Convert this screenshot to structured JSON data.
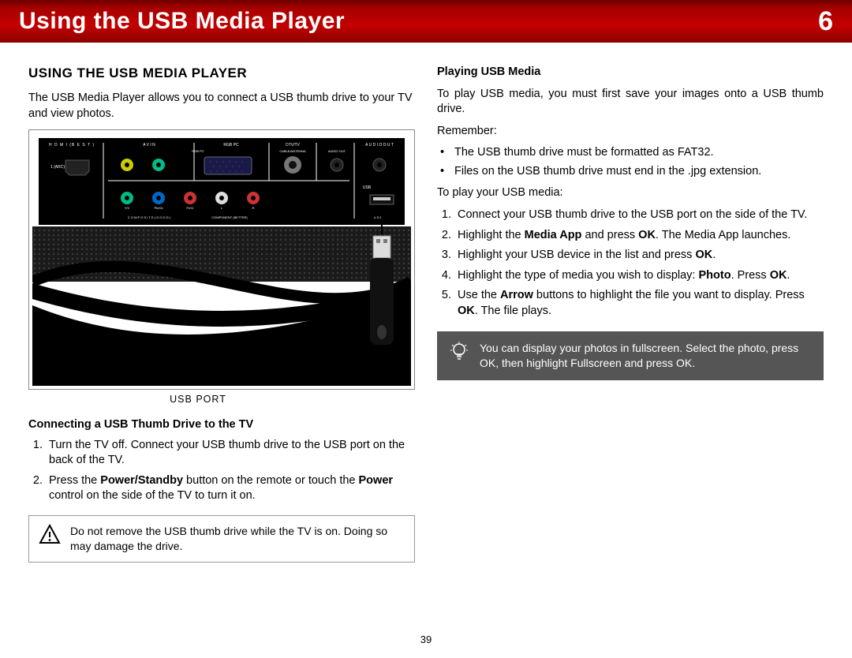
{
  "header": {
    "title": "Using the USB Media Player",
    "chapter": "6"
  },
  "left": {
    "h2": "USING THE USB MEDIA PLAYER",
    "intro": "The USB Media Player allows you to connect a USB thumb drive to your TV and view photos.",
    "usb_port_label": "USB PORT",
    "h3_connect": "Connecting a USB Thumb Drive to the TV",
    "steps_connect": [
      "Turn the TV off. Connect your USB thumb drive to the USB port on the back of the TV.",
      "Press the <b>Power/Standby</b> button on the remote or touch the <b>Power</b> control on the side of the TV to turn it on."
    ],
    "caution": "Do not remove the USB thumb drive while the TV is on. Doing so may damage the drive."
  },
  "right": {
    "h3_play": "Playing USB Media",
    "play_intro": "To play USB media, you must first save your images onto a USB thumb drive.",
    "remember_label": "Remember:",
    "remember_items": [
      "The USB thumb drive must be formatted as FAT32.",
      "Files on the USB thumb drive must end in the .jpg extension."
    ],
    "to_play_label": "To play your USB media:",
    "steps_play": [
      "Connect your USB thumb drive to the USB port on the side of the TV.",
      "Highlight the <b>Media App</b> and press <b>OK</b>. The Media App launches.",
      "Highlight your USB device in the list and press <b>OK</b>.",
      "Highlight the type of media you wish to display: <b>Photo</b>. Press <b>OK</b>.",
      "Use the <b>Arrow</b> buttons to highlight the file you want to display. Press <b>OK</b>. The file plays."
    ],
    "tip": "You can display your photos in fullscreen. Select the photo, press OK, then highlight Fullscreen and press OK."
  },
  "page_number": "39",
  "fig_labels": {
    "hdmi": "H D M I (B E S T )",
    "av_in": "A V  I N",
    "rgb_pc": "RGB PC",
    "dtv": "DTV/TV",
    "audio_out": "A U D I O O U T",
    "cable": "CABLE/ANTENNA",
    "audio_3": "AUDIO OUT",
    "yv": "Y/V",
    "pb": "Pb/Cb",
    "pr": "Pr/Cr",
    "l": "L",
    "r": "R",
    "usb": "USB",
    "comp": "C O M P O S I T E  ( G O O D )",
    "component": "COMPONENT (BETTER)",
    "usb2": "U S B",
    "arc": "1\n(ARC)"
  }
}
